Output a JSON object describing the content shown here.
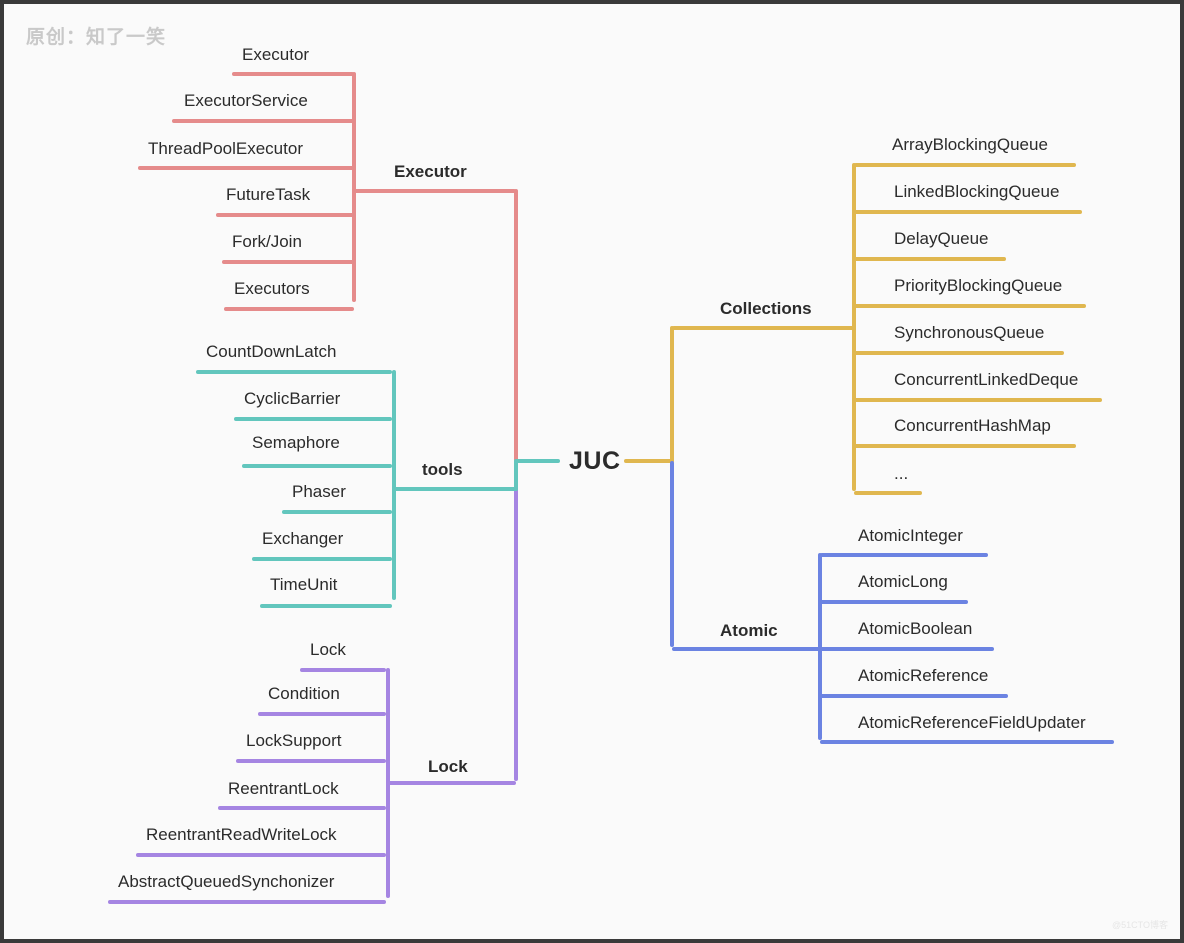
{
  "watermarks": {
    "top_left": "原创：知了一笑",
    "bottom_right": "@51CTO博客"
  },
  "root": {
    "label": "JUC"
  },
  "colors": {
    "background": "#fafafa",
    "border": "#3a3a3a",
    "text": "#2b2b2b",
    "executor": "#e58b8b",
    "tools": "#62c6bd",
    "lock": "#a585e2",
    "collections": "#e0b74f",
    "atomic": "#6b83e2",
    "watermark_top": "#c9c9c9",
    "watermark_bottom": "#e6e6e6"
  },
  "diagram": {
    "type": "mind-map",
    "title": "JUC",
    "branches": [
      {
        "label": "Executor",
        "color": "#e58b8b",
        "side": "left",
        "children": [
          "Executor",
          "ExecutorService",
          "ThreadPoolExecutor",
          "FutureTask",
          "Fork/Join",
          "Executors"
        ]
      },
      {
        "label": "tools",
        "color": "#62c6bd",
        "side": "left",
        "children": [
          "CountDownLatch",
          "CyclicBarrier",
          "Semaphore",
          "Phaser",
          "Exchanger",
          "TimeUnit"
        ]
      },
      {
        "label": "Lock",
        "color": "#a585e2",
        "side": "left",
        "children": [
          "Lock",
          "Condition",
          "LockSupport",
          "ReentrantLock",
          "ReentrantReadWriteLock",
          "AbstractQueuedSynchonizer"
        ]
      },
      {
        "label": "Collections",
        "color": "#e0b74f",
        "side": "right",
        "children": [
          "ArrayBlockingQueue",
          "LinkedBlockingQueue",
          "DelayQueue",
          "PriorityBlockingQueue",
          "SynchronousQueue",
          "ConcurrentLinkedDeque",
          "ConcurrentHashMap",
          "..."
        ]
      },
      {
        "label": "Atomic",
        "color": "#6b83e2",
        "side": "right",
        "children": [
          "AtomicInteger",
          "AtomicLong",
          "AtomicBoolean",
          "AtomicReference",
          "AtomicReferenceFieldUpdater"
        ]
      }
    ]
  },
  "branch_labels": {
    "executor": "Executor",
    "tools": "tools",
    "lock": "Lock",
    "collections": "Collections",
    "atomic": "Atomic"
  },
  "executor_children": {
    "c0": "Executor",
    "c1": "ExecutorService",
    "c2": "ThreadPoolExecutor",
    "c3": "FutureTask",
    "c4": "Fork/Join",
    "c5": "Executors"
  },
  "tools_children": {
    "c0": "CountDownLatch",
    "c1": "CyclicBarrier",
    "c2": "Semaphore",
    "c3": "Phaser",
    "c4": "Exchanger",
    "c5": "TimeUnit"
  },
  "lock_children": {
    "c0": "Lock",
    "c1": "Condition",
    "c2": "LockSupport",
    "c3": "ReentrantLock",
    "c4": "ReentrantReadWriteLock",
    "c5": "AbstractQueuedSynchonizer"
  },
  "collections_children": {
    "c0": "ArrayBlockingQueue",
    "c1": "LinkedBlockingQueue",
    "c2": "DelayQueue",
    "c3": "PriorityBlockingQueue",
    "c4": "SynchronousQueue",
    "c5": "ConcurrentLinkedDeque",
    "c6": "ConcurrentHashMap",
    "c7": "..."
  },
  "atomic_children": {
    "c0": "AtomicInteger",
    "c1": "AtomicLong",
    "c2": "AtomicBoolean",
    "c3": "AtomicReference",
    "c4": "AtomicReferenceFieldUpdater"
  }
}
